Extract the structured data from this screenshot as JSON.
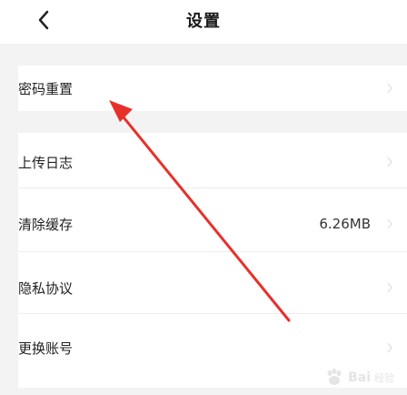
{
  "header": {
    "title": "设置",
    "back_icon": "chevron-left-icon"
  },
  "settings": {
    "items": [
      {
        "label": "密码重置",
        "value": ""
      },
      {
        "label": "上传日志",
        "value": ""
      },
      {
        "label": "清除缓存",
        "value": "6.26MB"
      },
      {
        "label": "隐私协议",
        "value": ""
      },
      {
        "label": "更换账号",
        "value": ""
      }
    ]
  },
  "annotation": {
    "arrow_color": "#e8302a"
  },
  "watermark": {
    "brand": "Bai",
    "sub": "经验"
  }
}
